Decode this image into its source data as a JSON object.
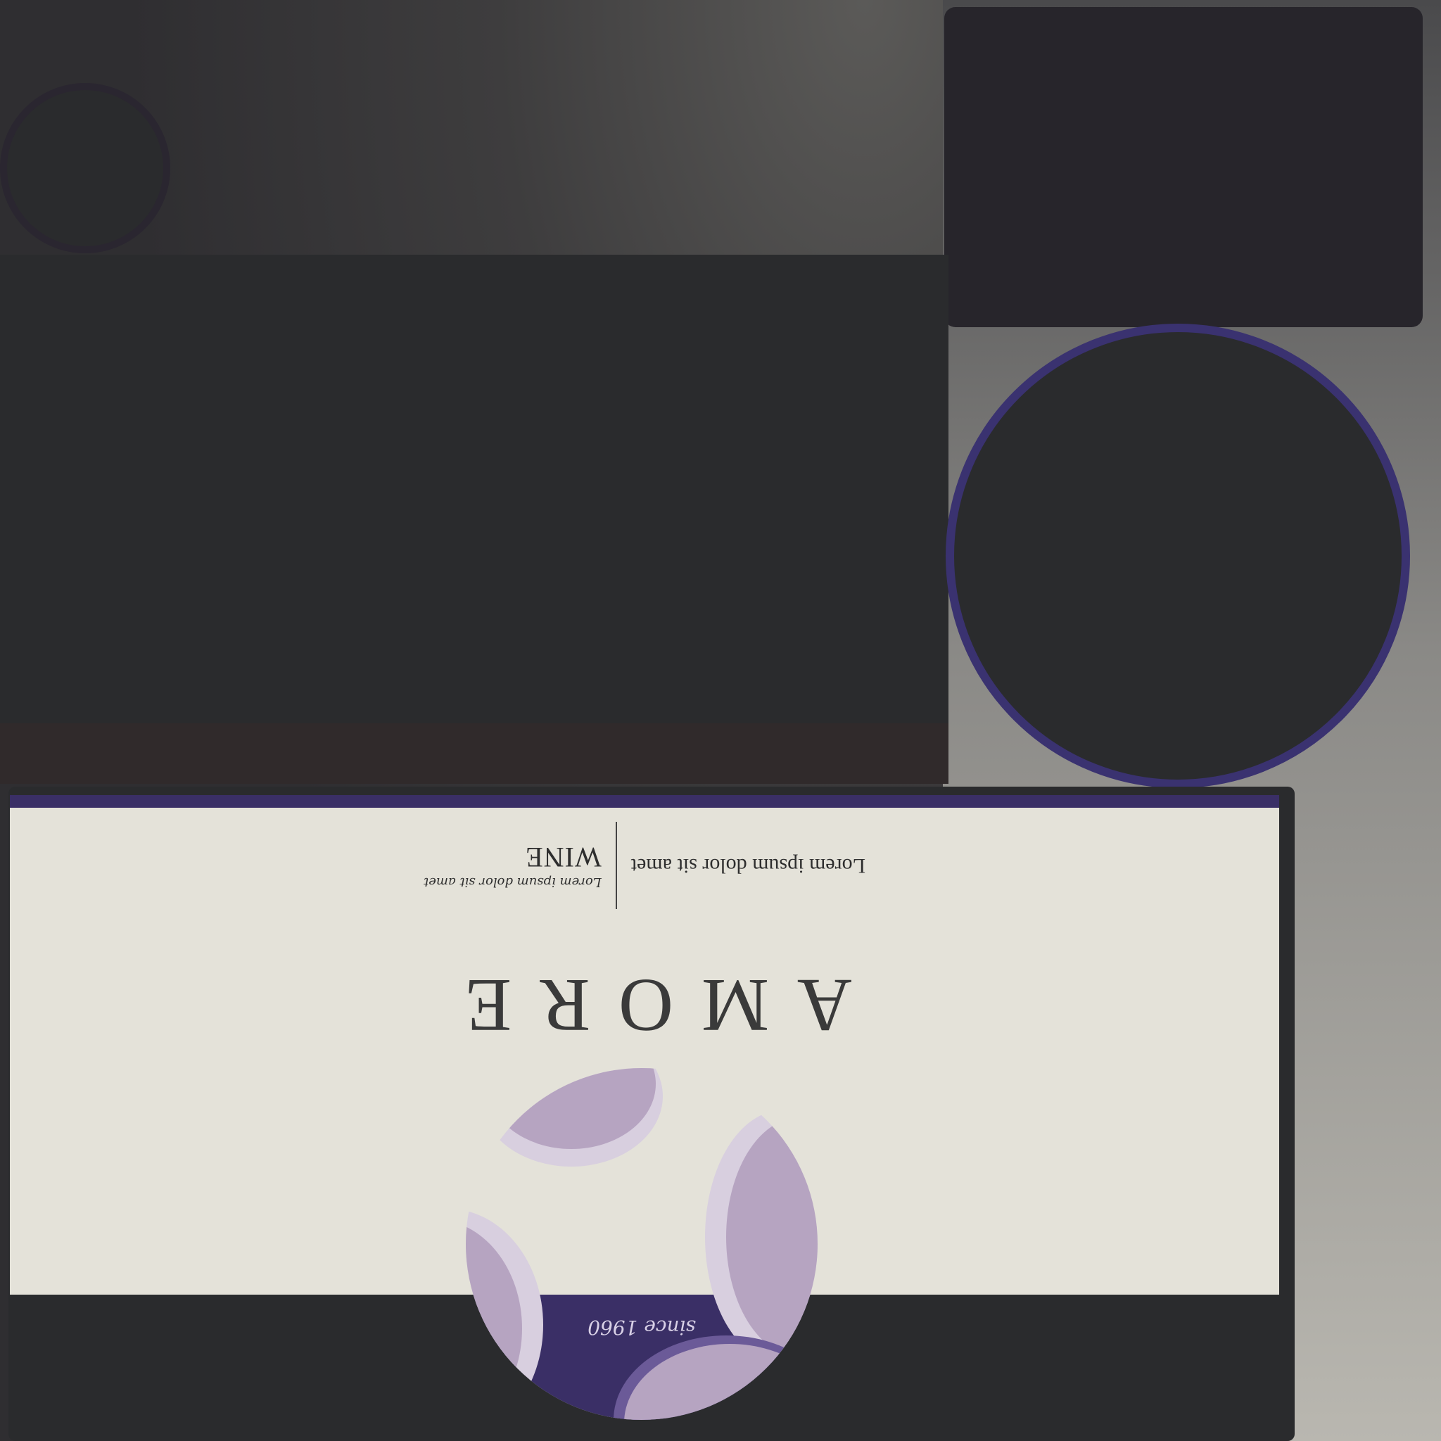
{
  "label": {
    "brand": "AMORE",
    "tagline_left": "Lorem ipsum dolor sit amet",
    "tagline_script": "Lorem ipsum dolor sit amet",
    "tagline_wine": "WINE",
    "since": "since 1960"
  },
  "colors": {
    "accent_purple": "#3a2f66",
    "petal_lilac": "#b6a4c1",
    "label_cream": "#e4e2d9",
    "dark_panel": "#2a2b2d"
  }
}
